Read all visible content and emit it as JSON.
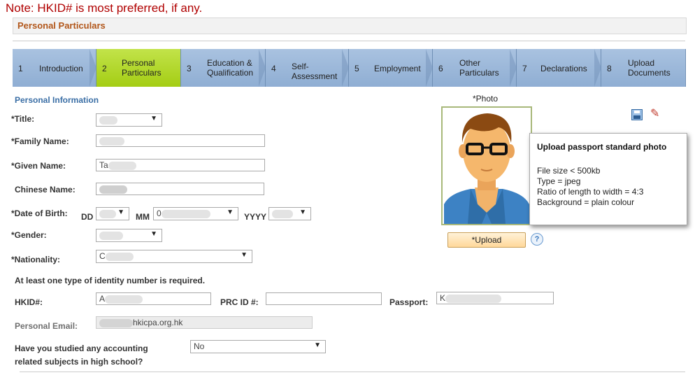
{
  "note": "Note: HKID# is most preferred, if any.",
  "section_title": "Personal Particulars",
  "steps": [
    {
      "num": "1",
      "label": "Introduction"
    },
    {
      "num": "2",
      "label": "Personal\nParticulars"
    },
    {
      "num": "3",
      "label": "Education &\nQualification"
    },
    {
      "num": "4",
      "label": "Self-\nAssessment"
    },
    {
      "num": "5",
      "label": "Employment"
    },
    {
      "num": "6",
      "label": "Other\nParticulars"
    },
    {
      "num": "7",
      "label": "Declarations"
    },
    {
      "num": "8",
      "label": "Upload\nDocuments"
    }
  ],
  "personal_info_heading": "Personal Information",
  "labels": {
    "title": "*Title:",
    "family_name": "*Family Name:",
    "given_name": "*Given Name:",
    "chinese_name": "Chinese Name:",
    "dob": "*Date of Birth:",
    "dd": "DD",
    "mm": "MM",
    "yyyy": "YYYY",
    "gender": "*Gender:",
    "nationality": "*Nationality:",
    "id_required": "At least one type of identity number is required.",
    "hkid": "HKID#:",
    "prc": "PRC ID #:",
    "passport": "Passport:",
    "email": "Personal Email:",
    "accounting_q1": "Have you studied any accounting",
    "accounting_q2": "related subjects in high school?"
  },
  "values": {
    "given_name_prefix": "Ta",
    "month_prefix": "0",
    "month_suffix": "January",
    "nationality_prefix": "C",
    "hkid_prefix": "A",
    "passport_prefix": "K",
    "email_suffix": "hkicpa.org.hk",
    "accounting_answer": "No"
  },
  "photo": {
    "label": "*Photo",
    "upload_button": "*Upload",
    "help": "?"
  },
  "popup": {
    "title": "Upload passport standard photo",
    "lines": [
      "File size < 500kb",
      "Type = jpeg",
      "Ratio of length to width = 4:3",
      "Background = plain colour"
    ]
  },
  "colors": {
    "note": "#b00000",
    "section_title": "#b2571b",
    "step": "#9fb9dc",
    "step_active": "#b5d92a",
    "heading": "#3a6ea5"
  }
}
